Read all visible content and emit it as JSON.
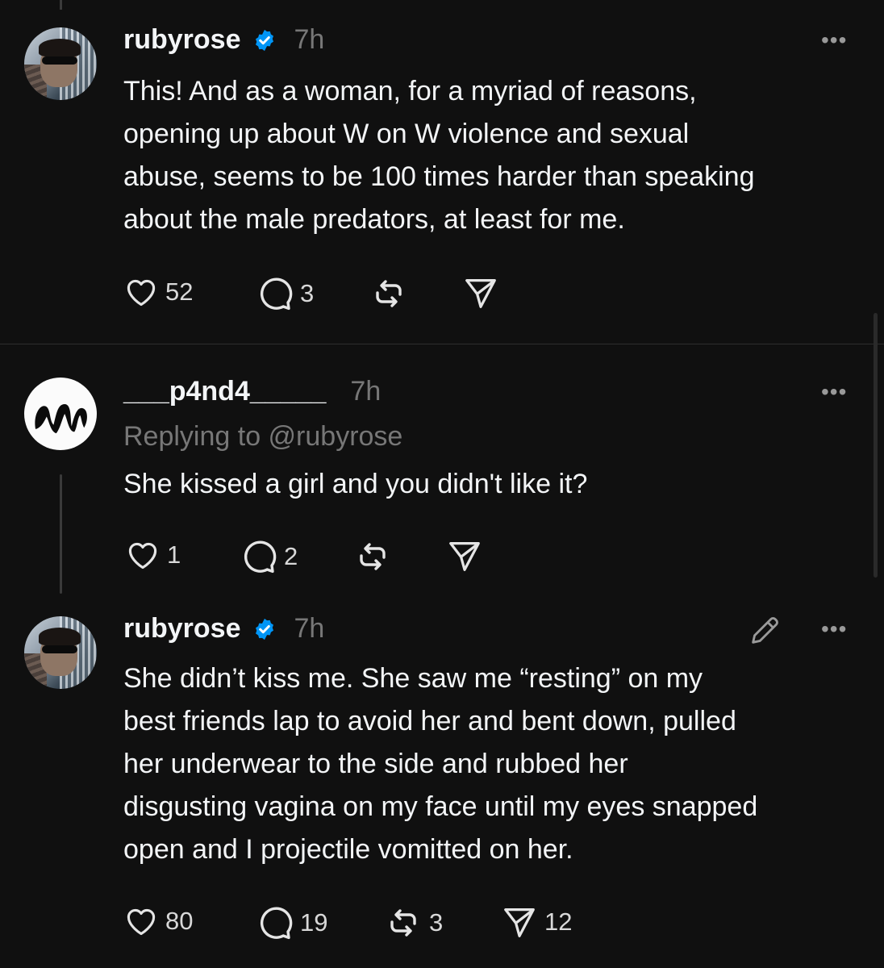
{
  "posts": [
    {
      "username": "rubyrose",
      "verified": true,
      "time": "7h",
      "more": "•••",
      "text": "This! And as a woman, for a myriad of reasons,\nopening up about W on W violence and sexual\nabuse, seems to be 100 times harder than speaking\nabout the male predators, at least for me.",
      "likes": "52",
      "replies": "3",
      "reposts": "",
      "shares": ""
    },
    {
      "username": "___p4nd4_____",
      "verified": false,
      "time": "7h",
      "more": "•••",
      "replying_to": "Replying to @rubyrose",
      "text": "She kissed a girl and you didn't like it?",
      "likes": "1",
      "replies": "2",
      "reposts": "",
      "shares": ""
    },
    {
      "username": "rubyrose",
      "verified": true,
      "time": "7h",
      "more": "•••",
      "text": "She didn’t kiss me. She saw me “resting” on my\nbest friends lap to avoid her and bent down, pulled\nher underwear to the side and rubbed her\ndisgusting vagina on my face until my eyes snapped\nopen and I projectile vomitted on her.",
      "likes": "80",
      "replies": "19",
      "reposts": "3",
      "shares": "12"
    }
  ],
  "colors": {
    "background": "#101010",
    "text": "#f3f5f7",
    "muted": "#777777",
    "verified": "#0095f6"
  }
}
